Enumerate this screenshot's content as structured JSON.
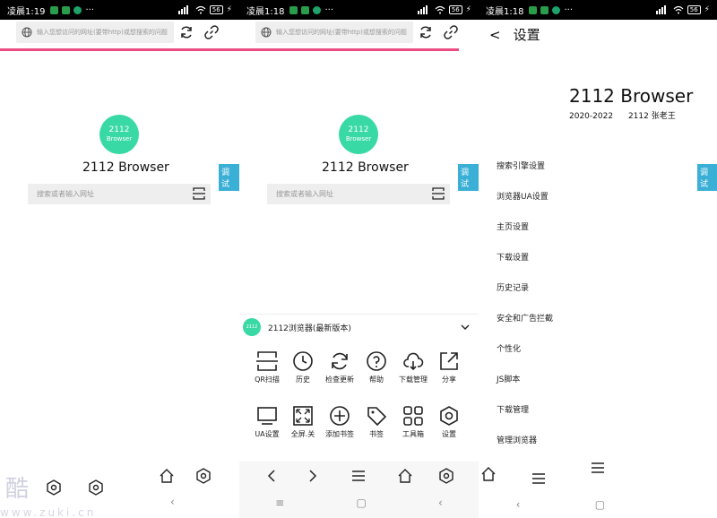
{
  "colors": {
    "accent_green": "#39d9a6",
    "progress_pink": "#ec4c83",
    "debug_blue": "#3bb0d6"
  },
  "screens": [
    {
      "status": {
        "time": "凌晨1:19",
        "battery": "56"
      },
      "url_placeholder": "输入您想访问的网址(要带http)或想搜索的问题",
      "logo": {
        "line1": "2112",
        "line2": "Browser"
      },
      "brand": "2112 Browser",
      "debug_label": "调试",
      "search_placeholder": "搜索或者输入网址"
    },
    {
      "status": {
        "time": "凌晨1:18",
        "battery": "56"
      },
      "url_placeholder": "输入您想访问的网址(要带http)或想搜索的问题",
      "logo": {
        "line1": "2112",
        "line2": "Browser"
      },
      "brand": "2112 Browser",
      "debug_label": "调试",
      "search_placeholder": "搜索或者输入网址",
      "sheet": {
        "logo_text": "2112",
        "title": "2112浏览器(最新版本)",
        "row1": [
          "QR扫描",
          "历史",
          "检查更新",
          "帮助",
          "下载管理",
          "分享"
        ],
        "row2": [
          "UA设置",
          "全屏.关",
          "添加书签",
          "书签",
          "工具箱",
          "设置"
        ]
      }
    },
    {
      "status": {
        "time": "凌晨1:18",
        "battery": "56"
      },
      "title": "设置",
      "back": "<",
      "brand": "2112 Browser",
      "years": "2020-2022",
      "author": "2112 张老王",
      "debug_label": "调试",
      "items": [
        "搜索引擎设置",
        "浏览器UA设置",
        "主页设置",
        "下载设置",
        "历史记录",
        "安全和广告拦截",
        "个性化",
        "JS脚本",
        "下载管理",
        "管理浏览器"
      ]
    }
  ],
  "watermark": {
    "char": "酷",
    "text": "www.zuki.cn"
  },
  "icons": [
    "globe-icon",
    "refresh-icon",
    "link-icon",
    "scan-icon",
    "home-icon",
    "hexagon-settings-icon",
    "chevron-down-icon",
    "back-icon",
    "forward-icon",
    "menu-icon"
  ]
}
